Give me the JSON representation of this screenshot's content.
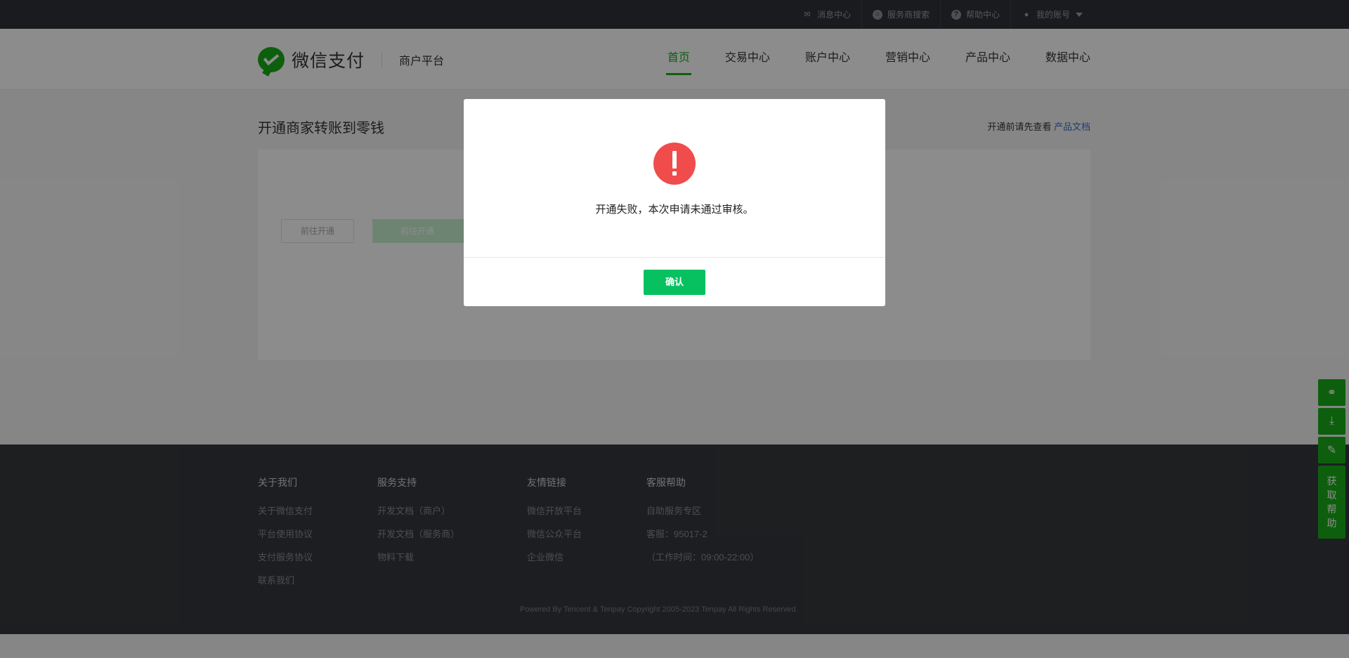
{
  "topbar": {
    "items": [
      {
        "label": "消息中心",
        "icon": "mail-icon"
      },
      {
        "label": "服务商搜索",
        "icon": "search-icon"
      },
      {
        "label": "帮助中心",
        "icon": "help-icon"
      },
      {
        "label": "我的账号",
        "icon": "user-icon"
      }
    ]
  },
  "header": {
    "brand": "微信支付",
    "sub": "商户平台",
    "nav": [
      "首页",
      "交易中心",
      "账户中心",
      "营销中心",
      "产品中心",
      "数据中心"
    ],
    "active_nav": "首页"
  },
  "main": {
    "title": "开通商家转账到零钱",
    "note_prefix": "开通前请先查看",
    "note_link": "产品文档",
    "btn_ghost": "前往开通",
    "btn_green": "前往开通"
  },
  "footer": {
    "columns": [
      {
        "title": "关于我们",
        "links": [
          "关于微信支付",
          "平台使用协议",
          "支付服务协议",
          "联系我们"
        ]
      },
      {
        "title": "服务支持",
        "links": [
          "开发文档（商户）",
          "开发文档（服务商）",
          "物料下载"
        ]
      },
      {
        "title": "友情链接",
        "links": [
          "微信开放平台",
          "微信公众平台",
          "企业微信"
        ]
      },
      {
        "title": "客服帮助",
        "links": [
          "自助服务专区",
          "客服：95017-2",
          "（工作时间：09:00-22:00）"
        ]
      }
    ],
    "copyright": "Powered By Tencent & Tenpay    Copyright 2005-2023 Tenpay All Rights Reserved."
  },
  "float_bar": {
    "icons": [
      "link-icon",
      "download-icon",
      "edit-icon"
    ],
    "help_label": "获取帮助"
  },
  "modal": {
    "icon": "error-icon",
    "message": "开通失败，本次申请未通过审核。",
    "confirm": "确认"
  },
  "colors": {
    "brand_green": "#1aad19",
    "button_green": "#07c160",
    "error_red": "#f04c4c",
    "link_blue": "#3c6ec6"
  }
}
